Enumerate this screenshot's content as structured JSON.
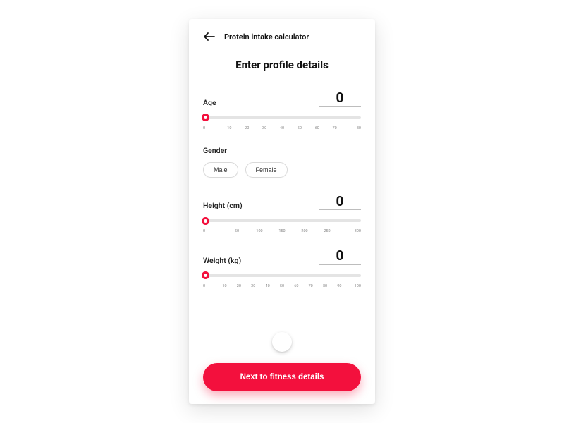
{
  "header": {
    "title": "Protein intake calculator"
  },
  "screen": {
    "heading": "Enter profile details"
  },
  "fields": {
    "age": {
      "label": "Age",
      "value": "0",
      "ticks": [
        "0",
        "10",
        "20",
        "30",
        "40",
        "50",
        "60",
        "70",
        "80"
      ]
    },
    "gender": {
      "label": "Gender",
      "options": {
        "male": "Male",
        "female": "Female"
      }
    },
    "height": {
      "label": "Height (cm)",
      "value": "0",
      "ticks": [
        "0",
        "50",
        "100",
        "150",
        "200",
        "250",
        "300"
      ]
    },
    "weight": {
      "label": "Weight (kg)",
      "value": "0",
      "ticks": [
        "0",
        "10",
        "20",
        "30",
        "40",
        "50",
        "60",
        "70",
        "80",
        "90",
        "100"
      ]
    }
  },
  "cta": {
    "label": "Next to fitness details"
  },
  "colors": {
    "accent": "#f3103d"
  }
}
